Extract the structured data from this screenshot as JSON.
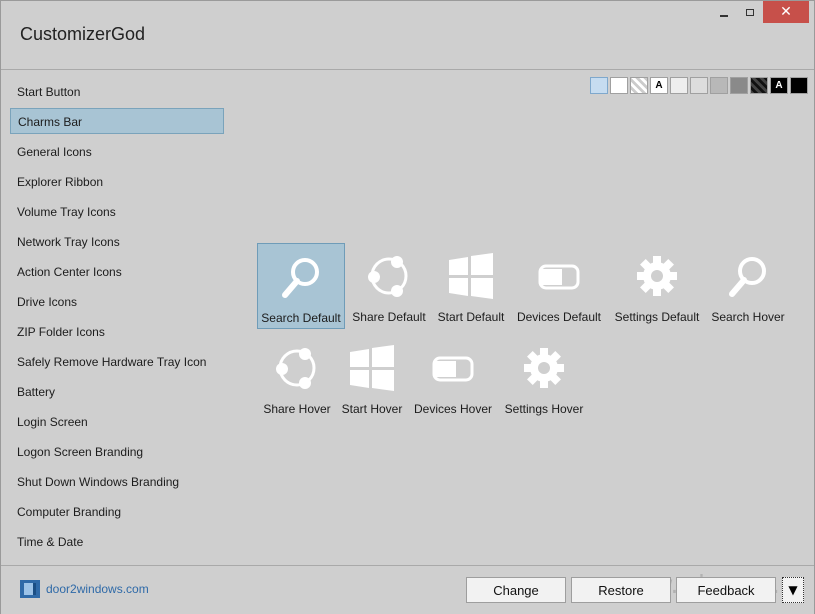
{
  "window": {
    "title": "CustomizerGod",
    "close_glyph": "✕"
  },
  "sidebar": {
    "items": [
      {
        "label": "Start Button"
      },
      {
        "label": "Charms Bar",
        "active": true
      },
      {
        "label": "General Icons"
      },
      {
        "label": "Explorer Ribbon"
      },
      {
        "label": "Volume Tray Icons"
      },
      {
        "label": "Network Tray Icons"
      },
      {
        "label": "Action Center Icons"
      },
      {
        "label": "Drive Icons"
      },
      {
        "label": "ZIP Folder Icons"
      },
      {
        "label": "Safely Remove Hardware Tray Icon"
      },
      {
        "label": "Battery"
      },
      {
        "label": "Login Screen"
      },
      {
        "label": "Logon Screen Branding"
      },
      {
        "label": "Shut Down Windows Branding"
      },
      {
        "label": "Computer Branding"
      },
      {
        "label": "Time & Date"
      }
    ]
  },
  "swatches": {
    "selected_color": "#c6dcf0",
    "letter": "A"
  },
  "icons": [
    {
      "label": "Search Default",
      "icon": "search-icon",
      "selected": true
    },
    {
      "label": "Share Default",
      "icon": "share-icon"
    },
    {
      "label": "Start Default",
      "icon": "windows-start-icon"
    },
    {
      "label": "Devices Default",
      "icon": "devices-icon"
    },
    {
      "label": "Settings Default",
      "icon": "gear-icon"
    },
    {
      "label": "Search Hover",
      "icon": "search-icon"
    },
    {
      "label": "Share Hover",
      "icon": "share-icon"
    },
    {
      "label": "Start Hover",
      "icon": "windows-start-icon"
    },
    {
      "label": "Devices Hover",
      "icon": "devices-icon"
    },
    {
      "label": "Settings Hover",
      "icon": "gear-icon"
    }
  ],
  "footer": {
    "brand_text": "door2windows.com",
    "change_label": "Change",
    "restore_label": "Restore",
    "feedback_label": "Feedback",
    "dropdown_glyph": "▼",
    "watermark": "www.wincore.ru"
  },
  "colors": {
    "accent": "#a8c4d4",
    "background": "#cfcfcf",
    "close": "#c7504a",
    "brand_link": "#2f6aa8"
  }
}
